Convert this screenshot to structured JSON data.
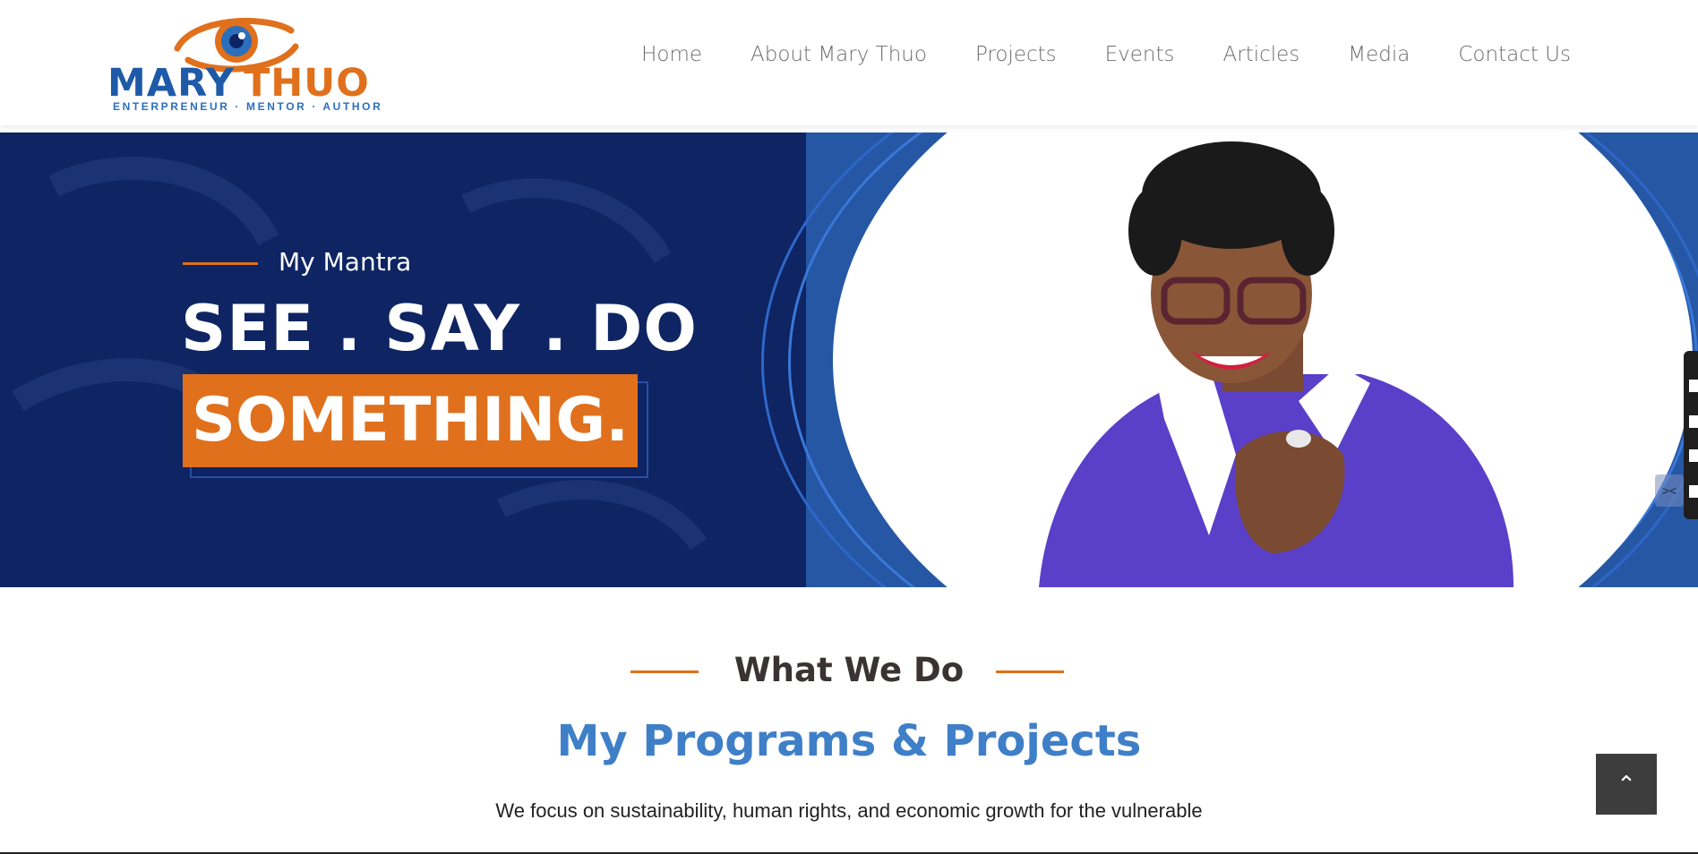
{
  "header": {
    "logo": {
      "brand_first": "MARY",
      "brand_second": "THUO",
      "tagline": "ENTERPRENEUR · MENTOR · AUTHOR"
    },
    "nav": [
      "Home",
      "About Mary Thuo",
      "Projects",
      "Events",
      "Articles",
      "Media",
      "Contact Us"
    ]
  },
  "hero": {
    "eyebrow": "My Mantra",
    "headline_line1": "SEE . SAY . DO",
    "headline_line2": "SOMETHING."
  },
  "section": {
    "title": "What We Do",
    "heading": "My Programs & Projects",
    "subtitle": "We focus on sustainability, human rights, and economic growth for the vulnerable"
  },
  "widgets": {
    "collapse_icon": "collapse-arrows-icon",
    "scroll_top_icon": "chevron-up-icon"
  },
  "colors": {
    "brand_blue": "#0e2463",
    "accent_orange": "#e0701c",
    "heading_blue": "#3f7fc8"
  }
}
